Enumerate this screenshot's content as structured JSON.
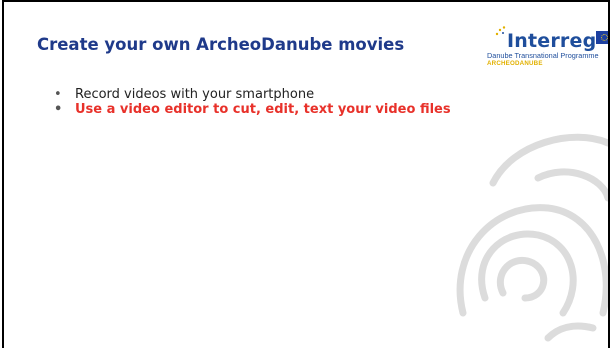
{
  "slide": {
    "title": "Create your own ArcheoDanube movies",
    "bullets": [
      {
        "text": "Record videos with your smartphone"
      },
      {
        "text": "Use a video editor to cut, edit, text your video files"
      }
    ],
    "bullet_glyph": "•"
  },
  "logo": {
    "name": "Interreg",
    "subtitle": "Danube Transnational Programme",
    "project": "ARCHEODANUBE"
  },
  "colors": {
    "title": "#1f3a8a",
    "highlight": "#e8312a",
    "logo_blue": "#1f4e9c",
    "logo_yellow": "#e2b100"
  }
}
